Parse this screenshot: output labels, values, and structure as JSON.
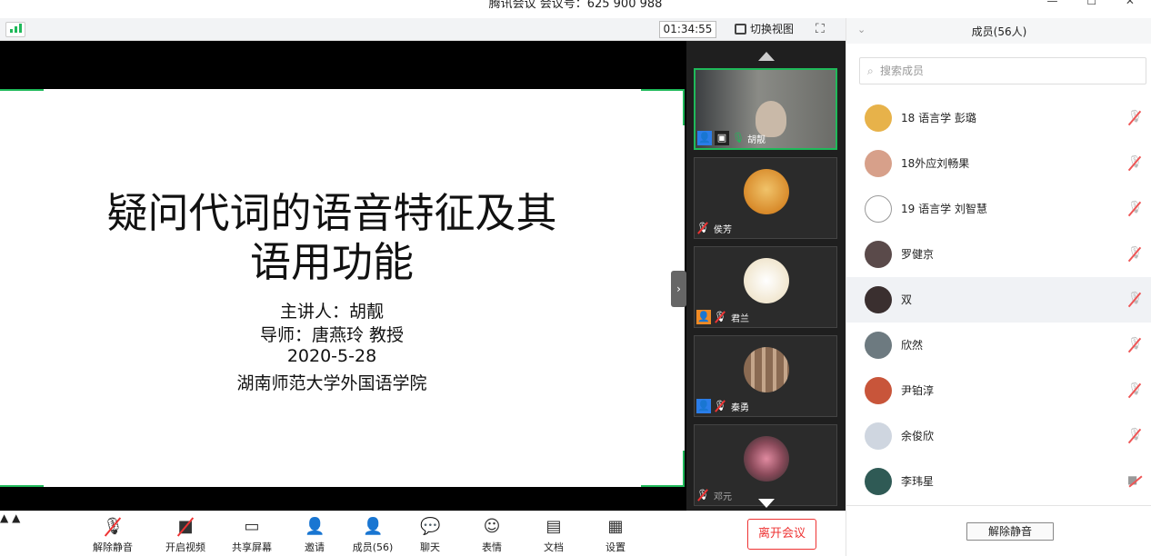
{
  "window": {
    "title": "腾讯会议 会议号：625 900 988",
    "controls": "— ☐ ✕"
  },
  "topbar": {
    "timer": "01:34:55",
    "switch_view": "切换视图"
  },
  "slide": {
    "title_line1": "疑问代词的语音特征及其",
    "title_line2": "语用功能",
    "speaker": "主讲人：胡靓",
    "advisor": "导师：唐燕玲 教授",
    "date": "2020-5-28",
    "institution": "湖南师范大学外国语学院"
  },
  "gallery": [
    {
      "name": "胡靓",
      "active": true,
      "mic": "on",
      "tag": "blue"
    },
    {
      "name": "侯芳",
      "active": false,
      "mic": "off",
      "tag": ""
    },
    {
      "name": "君兰",
      "active": false,
      "mic": "off",
      "tag": "orange"
    },
    {
      "name": "秦勇",
      "active": false,
      "mic": "off",
      "tag": "blue"
    },
    {
      "name": "邓元",
      "active": false,
      "mic": "off",
      "tag": ""
    }
  ],
  "toolbar": {
    "unmute": "解除静音",
    "video": "开启视频",
    "share": "共享屏幕",
    "invite": "邀请",
    "members": "成员(56)",
    "chat": "聊天",
    "emoji": "表情",
    "docs": "文档",
    "settings": "设置",
    "leave": "离开会议"
  },
  "panel": {
    "title": "成员(56人)",
    "search_placeholder": "搜索成员",
    "members": [
      {
        "name": "18 语言学 彭璐",
        "status": "muted",
        "color": "#e7b24a"
      },
      {
        "name": "18外应刘畅果",
        "status": "muted",
        "color": "#d7a08a"
      },
      {
        "name": "19 语言学 刘智慧",
        "status": "muted",
        "color": "#ffffff"
      },
      {
        "name": "罗健京",
        "status": "muted",
        "color": "#5a4a4a"
      },
      {
        "name": "双",
        "status": "muted",
        "color": "#3a2f2f"
      },
      {
        "name": "欣然",
        "status": "muted",
        "color": "#6d7a80"
      },
      {
        "name": "尹铂淳",
        "status": "muted",
        "color": "#c8553a"
      },
      {
        "name": "余俊欣",
        "status": "muted",
        "color": "#cfd6e0"
      },
      {
        "name": "李玮星",
        "status": "video-off",
        "color": "#2f5a55"
      }
    ],
    "footer_button": "解除静音"
  },
  "colors": {
    "accent_green": "#1fb95a",
    "leave_red": "#e33333",
    "mute_red": "#e55555"
  }
}
